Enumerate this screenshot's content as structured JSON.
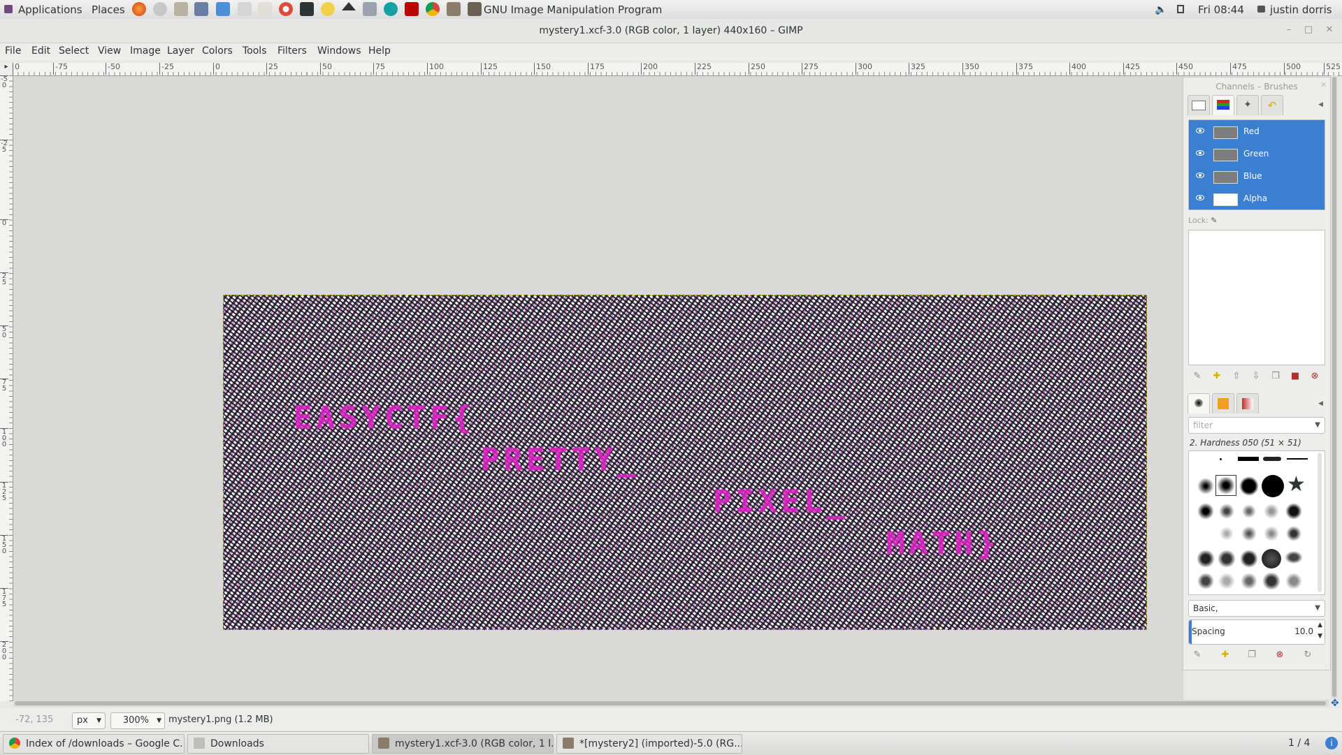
{
  "top_panel": {
    "applications": "Applications",
    "places": "Places",
    "active_app": "GNU Image Manipulation Program",
    "clock": "Fri 08:44",
    "user": "justin dorris"
  },
  "window": {
    "title": "mystery1.xcf-3.0 (RGB color, 1 layer) 440x160 – GIMP"
  },
  "menu": [
    "File",
    "Edit",
    "Select",
    "View",
    "Image",
    "Layer",
    "Colors",
    "Tools",
    "Filters",
    "Windows",
    "Help"
  ],
  "ruler": {
    "h_labels": [
      "0",
      "-75",
      "-50",
      "-25",
      "0",
      "25",
      "50",
      "75",
      "100",
      "125",
      "150",
      "175",
      "200",
      "225",
      "250",
      "275",
      "300",
      "325",
      "350",
      "375",
      "400",
      "425",
      "450",
      "475",
      "500",
      "525"
    ],
    "v_labels": [
      "-50",
      "-25",
      "0",
      "25",
      "50",
      "75",
      "100",
      "125",
      "150",
      "175",
      "200"
    ]
  },
  "canvas": {
    "hidden_text": [
      "EASYCTF{",
      "PRETTY_",
      "PIXEL_",
      "MATH}"
    ]
  },
  "statusbar": {
    "coords": "-72, 135",
    "unit": "px",
    "zoom": "300%",
    "file_info": "mystery1.png (1.2 MB)"
  },
  "dock": {
    "title": "Channels – Brushes",
    "channels": [
      "Red",
      "Green",
      "Blue",
      "Alpha"
    ],
    "lock_label": "Lock:",
    "filter_placeholder": "filter",
    "brush_name": "2. Hardness 050 (51 × 51)",
    "preset": "Basic,",
    "spacing_label": "Spacing",
    "spacing_value": "10.0"
  },
  "taskbar": {
    "tasks": [
      "Index of /downloads – Google C...",
      "Downloads",
      "mystery1.xcf-3.0 (RGB color, 1 l...",
      "*[mystery2] (imported)-5.0 (RG..."
    ],
    "workspace": "1 / 4"
  }
}
